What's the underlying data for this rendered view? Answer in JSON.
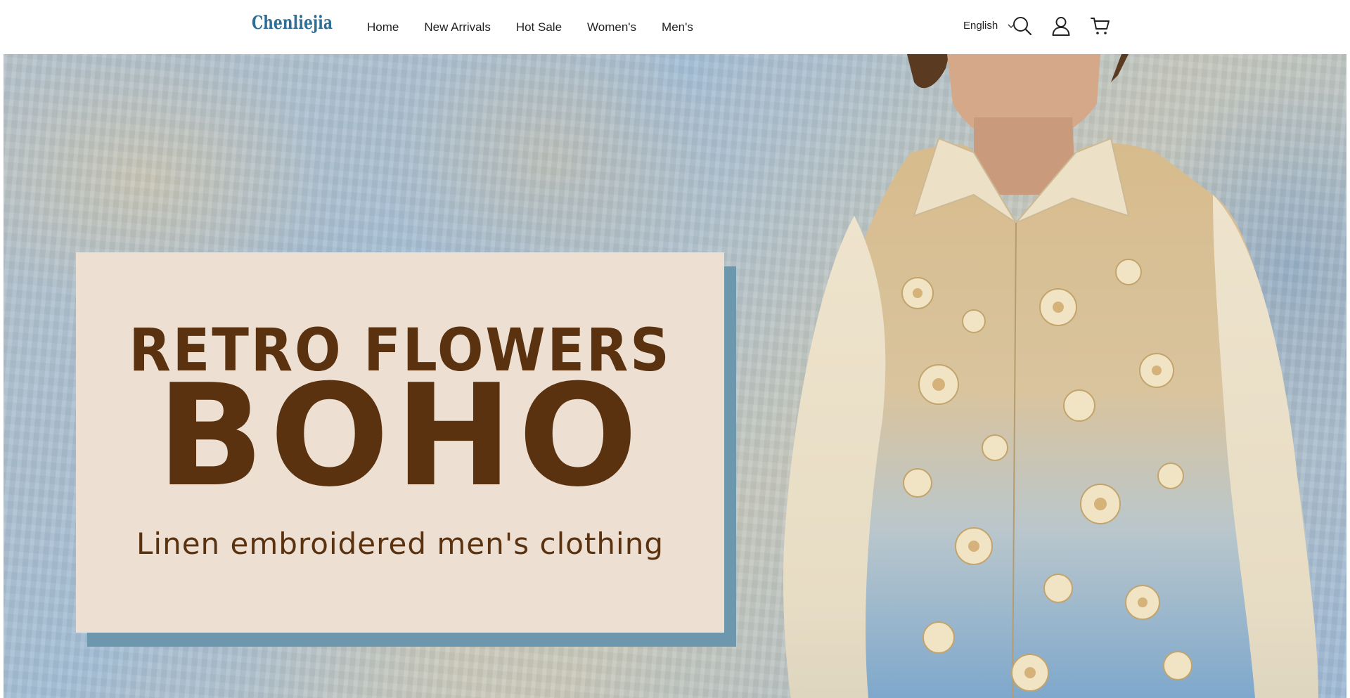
{
  "header": {
    "logo_text": "Chenliejia",
    "nav": [
      {
        "label": "Home"
      },
      {
        "label": "New Arrivals"
      },
      {
        "label": "Hot Sale"
      },
      {
        "label": "Women's"
      },
      {
        "label": "Men's"
      }
    ],
    "language": "English",
    "icons": [
      "search-icon",
      "account-icon",
      "cart-icon",
      "chevron-down-icon"
    ]
  },
  "hero": {
    "line1": "RETRO FLOWERS",
    "line2": "BOHO",
    "line3": "Linen embroidered men's clothing"
  },
  "colors": {
    "logo": "#2e6f97",
    "promo_text": "#5a3210",
    "promo_card": "#ede0d3",
    "promo_shadow": "#6d97ad"
  }
}
